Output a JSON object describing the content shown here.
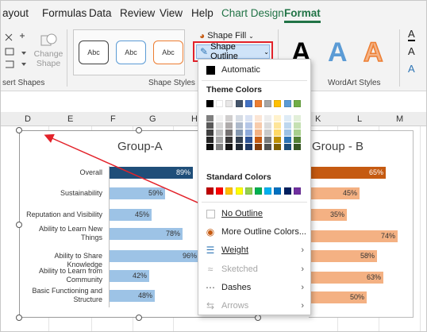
{
  "tabs": [
    "ayout",
    "Formulas",
    "Data",
    "Review",
    "View",
    "Help",
    "Chart Design",
    "Format"
  ],
  "ribbon": {
    "insert_shapes": {
      "change_shape": "Change Shape",
      "group_label": "sert Shapes"
    },
    "shape_styles": {
      "samples": [
        "Abc",
        "Abc",
        "Abc"
      ],
      "group_label": "Shape Styles",
      "sample_colors": [
        "#404040",
        "#5b9bd5",
        "#ed7d31"
      ]
    },
    "shape_fill_label": "Shape Fill",
    "shape_outline_label": "Shape Outline",
    "wordart": {
      "group_label": "WordArt Styles",
      "letters": [
        "A",
        "A",
        "A"
      ]
    },
    "text_icons": [
      "A",
      "A",
      "A"
    ]
  },
  "columns": [
    "D",
    "E",
    "F",
    "G",
    "H",
    "K",
    "L",
    "M"
  ],
  "chart_data": [
    {
      "type": "bar",
      "title": "Group-A",
      "categories": [
        "Overall",
        "Sustainability",
        "Reputation and Visibility",
        "Ability to Learn New Things",
        "Ability to Share Knowledge",
        "Ability to Learn from Community",
        "Basic Functioning and Structure"
      ],
      "values": [
        89,
        59,
        45,
        78,
        96,
        42,
        48
      ],
      "value_labels": [
        "89%",
        "59%",
        "45%",
        "78%",
        "96%",
        "42%",
        "48%"
      ],
      "colors": {
        "overall": "#1f4e79",
        "bars": "#9dc3e6"
      }
    },
    {
      "type": "bar",
      "title": "Group - B",
      "categories": [
        "Overall",
        "Sustainability",
        "Reputation and Visibility",
        "Ability to Learn New Things",
        "Ability to Share Knowledge",
        "Ability to Learn from Community",
        "Basic Functioning and Structure"
      ],
      "values": [
        65,
        45,
        35,
        74,
        58,
        63,
        50
      ],
      "value_labels": [
        "65%",
        "45%",
        "35%",
        "74%",
        "58%",
        "63%",
        "50%"
      ],
      "colors": {
        "overall": "#c55a11",
        "bars": "#f4b183"
      }
    }
  ],
  "menu": {
    "automatic": "Automatic",
    "theme_colors_label": "Theme Colors",
    "theme_top": [
      "#000000",
      "#ffffff",
      "#e7e6e6",
      "#44546a",
      "#4472c4",
      "#ed7d31",
      "#a5a5a5",
      "#ffc000",
      "#5b9bd5",
      "#70ad47"
    ],
    "theme_shades": [
      [
        "#7f7f7f",
        "#595959",
        "#404040",
        "#262626",
        "#0d0d0d"
      ],
      [
        "#f2f2f2",
        "#d9d9d9",
        "#bfbfbf",
        "#a6a6a6",
        "#7f7f7f"
      ],
      [
        "#d0cece",
        "#aeabab",
        "#757171",
        "#3a3838",
        "#171616"
      ],
      [
        "#d6dce4",
        "#adb9ca",
        "#8497b0",
        "#333f4f",
        "#222a35"
      ],
      [
        "#d9e2f3",
        "#b4c6e7",
        "#8eaadb",
        "#2f5496",
        "#1f3864"
      ],
      [
        "#fbe5d5",
        "#f7cbac",
        "#f4b183",
        "#c55a11",
        "#833c0b"
      ],
      [
        "#ededed",
        "#dbdbdb",
        "#c9c9c9",
        "#7b7b7b",
        "#525252"
      ],
      [
        "#fff2cc",
        "#fee599",
        "#ffd965",
        "#bf9000",
        "#7f6000"
      ],
      [
        "#deebf6",
        "#bdd7ee",
        "#9cc2e5",
        "#2e75b5",
        "#1e4e79"
      ],
      [
        "#e2efd9",
        "#c5e0b3",
        "#a8d08d",
        "#538135",
        "#375623"
      ]
    ],
    "standard_colors_label": "Standard Colors",
    "standard": [
      "#c00000",
      "#ff0000",
      "#ffc000",
      "#ffff00",
      "#92d050",
      "#00b050",
      "#00b0f0",
      "#0070c0",
      "#002060",
      "#7030a0"
    ],
    "no_outline": "No Outline",
    "more_colors": "More Outline Colors...",
    "weight": "Weight",
    "sketched": "Sketched",
    "dashes": "Dashes",
    "arrows": "Arrows"
  }
}
